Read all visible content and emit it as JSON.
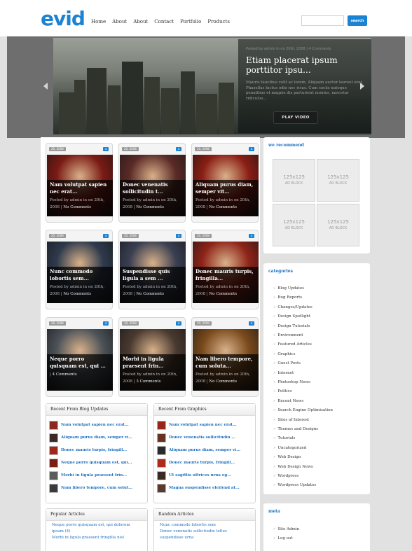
{
  "logo": "evid",
  "nav": [
    "Home",
    "About",
    "About",
    "Contact",
    "Portfolio",
    "Products"
  ],
  "search": {
    "button": "search"
  },
  "slider": {
    "meta": "Posted by admin in on 20th, 2008 | 4 Comments",
    "title": "Etiam placerat ipsum porttitor ipsu...",
    "excerpt": "Mauris faucibus velit ac lorem. Aliquam auctor laoreet erat. Phasellus luctus odio nec risus. Cum sociis natoque penatibus et magnis dis parturient montes, nascetur ridiculus...",
    "button": "PLAY VIDEO"
  },
  "posts": [
    {
      "date": "20, 2008",
      "comments": "4",
      "title": "Nam volutpat sapien nec erat...",
      "meta": "Posted by admin in on 20th, 2008",
      "comment_text": "No Comments",
      "color": "#7a1a14"
    },
    {
      "date": "20, 2008",
      "comments": "4",
      "title": "Donec venenatis sollicitudin t...",
      "meta": "Posted by admin in on 20th, 2008",
      "comment_text": "No Comments",
      "color": "#5a2a26"
    },
    {
      "date": "20, 2008",
      "comments": "4",
      "title": "Aliquam purus diam, semper vit...",
      "meta": "Posted by admin in on 20th, 2008",
      "comment_text": "No Comments",
      "color": "#8a1e14"
    },
    {
      "date": "20, 2008",
      "comments": "4",
      "title": "Nunc commodo lobortis sem...",
      "meta": "Posted by admin in on 20th, 2008",
      "comment_text": "No Comments",
      "color": "#2e3a4c"
    },
    {
      "date": "20, 2008",
      "comments": "4",
      "title": "Suspendisse quis ligula a sem ...",
      "meta": "Posted by admin in on 20th, 2008",
      "comment_text": "No Comments",
      "color": "#3a3f52"
    },
    {
      "date": "20, 2008",
      "comments": "4",
      "title": "Donec mauris turpis, fringilla...",
      "meta": "Posted by admin in on 20th, 2008",
      "comment_text": "No Comments",
      "color": "#8e2418"
    },
    {
      "date": "20, 2008",
      "comments": "4",
      "title": "Neque porro quisquam est, qui ...",
      "meta": "",
      "comment_text": "4 Comments",
      "color": "#4c5258"
    },
    {
      "date": "20, 2008",
      "comments": "4",
      "title": "Morbi in ligula praesent frin...",
      "meta": "Posted by admin in on 20th, 2008",
      "comment_text": "3 Comments",
      "color": "#4a3a30"
    },
    {
      "date": "20, 2008",
      "comments": "4",
      "title": "Nam libero tempore, cum soluta...",
      "meta": "Posted by admin in on 20th, 2008",
      "comment_text": "No Comments",
      "color": "#7a4a1c"
    }
  ],
  "recent_blog": {
    "title": "Recent From Blog Updates",
    "items": [
      "Nam volutpat sapien nec erat...",
      "Aliquam purus diam, semper vi...",
      "Donec mauris turpis, fringill...",
      "Neque porro quisquam est, qui...",
      "Morbi in ligula praesent frin...",
      "Nam libero tempore, cum solut..."
    ]
  },
  "recent_graphics": {
    "title": "Recent From Graphics",
    "items": [
      "Nam volutpat sapien nec erat...",
      "Donec venenatis sollicitudin ...",
      "Aliquam purus diam, semper vi...",
      "Donec mauris turpis, fringill...",
      "Ut sagittis ultrices urna eg...",
      "Magna suspendisse eleifend at..."
    ]
  },
  "popular": {
    "title": "Popular Articles",
    "items": [
      "Neque porro quisquam est, qui dolorem ipsum (4)",
      "Morbi in ligula praesent fringilla nisl"
    ]
  },
  "random": {
    "title": "Random Articles",
    "items": [
      "Nunc commodo lobortis sem",
      "Donec venenatis sollicitudin tellus suspendisse urna"
    ]
  },
  "recommend": {
    "title": "we recommend",
    "ads": [
      {
        "size": "125x125",
        "label": "AD BLOCK"
      },
      {
        "size": "125x125",
        "label": "AD BLOCK"
      },
      {
        "size": "125x125",
        "label": "AD BLOCK"
      },
      {
        "size": "125x125",
        "label": "AD BLOCK"
      }
    ]
  },
  "categories": {
    "title": "categories",
    "items": [
      "Blog Updates",
      "Bug Reports",
      "Changes/Updates",
      "Design Spotlight",
      "Design Tutorials",
      "Environment",
      "Featured Articles",
      "Graphics",
      "Guest Posts",
      "Internet",
      "Photoshop News",
      "Politics",
      "Recent News",
      "Search Engine Optimisation",
      "Sites of Interest",
      "Themes and Designs",
      "Tutorials",
      "Uncategorized",
      "Web Design",
      "Web Design News",
      "Wordpress",
      "Wordpress Updates"
    ]
  },
  "meta": {
    "title": "meta",
    "items": [
      "Site Admin",
      "Log out"
    ]
  },
  "colors": {
    "accent": "#1b83d2",
    "link": "#1b6fc0"
  }
}
